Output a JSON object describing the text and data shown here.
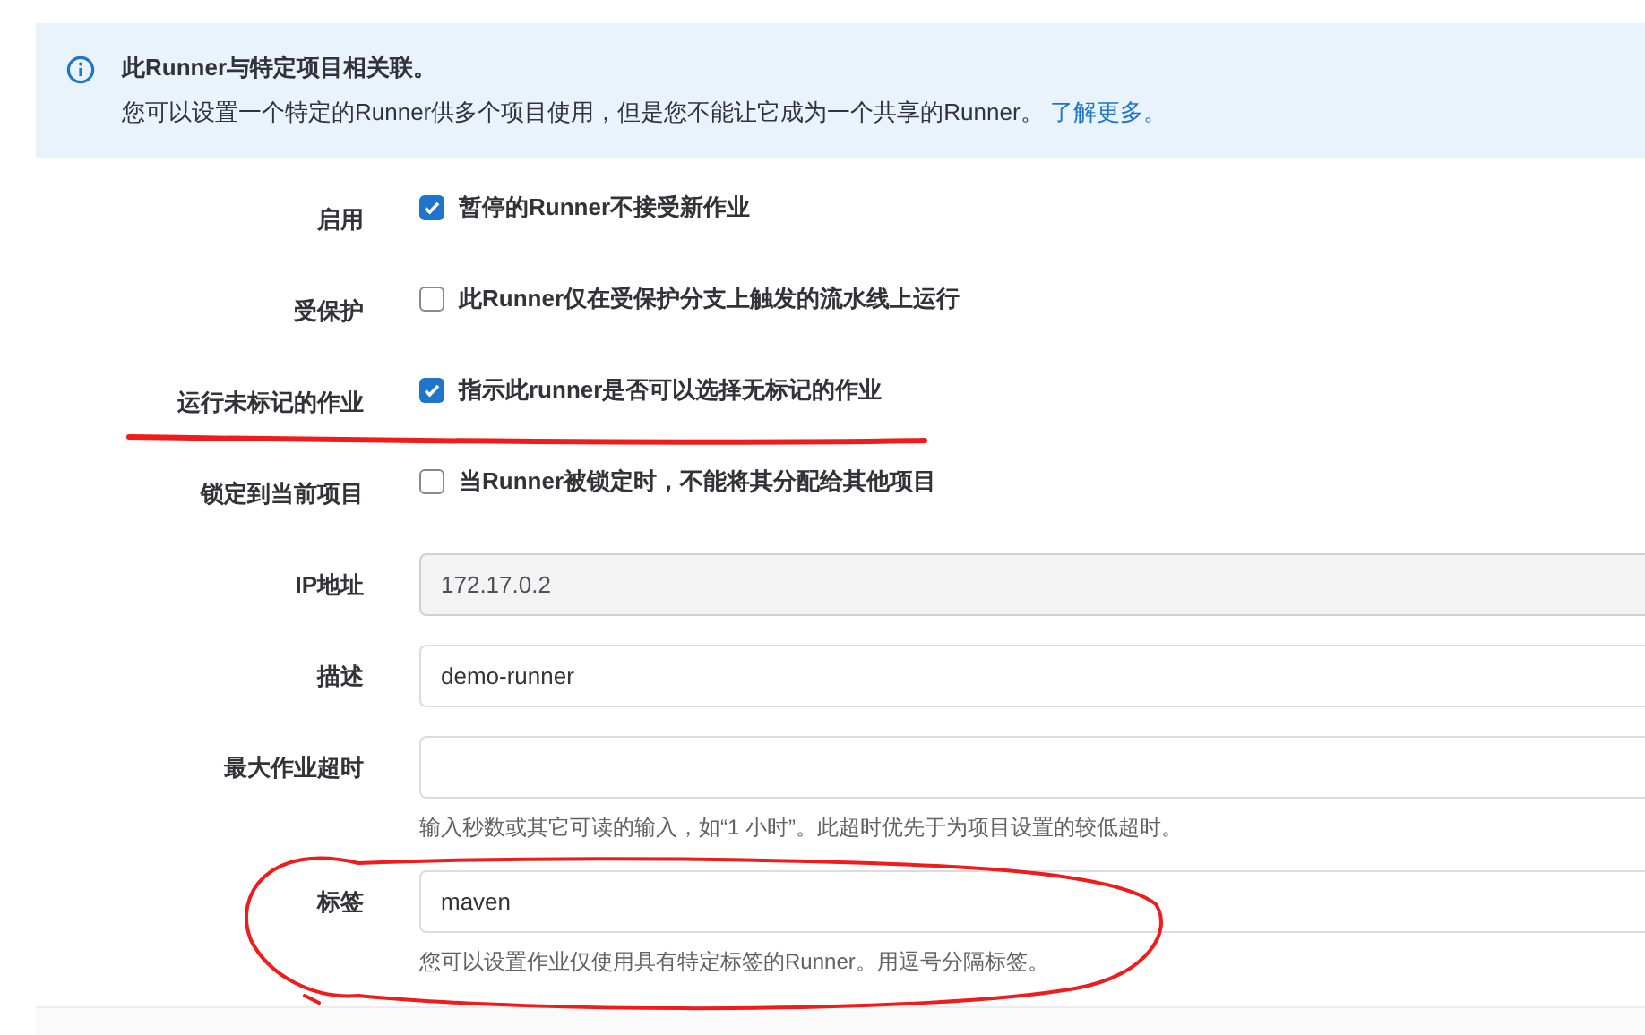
{
  "alert": {
    "title": "此Runner与特定项目相关联。",
    "text": "您可以设置一个特定的Runner供多个项目使用，但是您不能让它成为一个共享的Runner。",
    "link": "了解更多。"
  },
  "checkboxes": [
    {
      "label": "启用",
      "text": "暂停的Runner不接受新作业",
      "checked": true
    },
    {
      "label": "受保护",
      "text": "此Runner仅在受保护分支上触发的流水线上运行",
      "checked": false
    },
    {
      "label": "运行未标记的作业",
      "text": "指示此runner是否可以选择无标记的作业",
      "checked": true
    },
    {
      "label": "锁定到当前项目",
      "text": "当Runner被锁定时，不能将其分配给其他项目",
      "checked": false
    }
  ],
  "fields": [
    {
      "label": "IP地址",
      "value": "172.17.0.2",
      "readonly": true
    },
    {
      "label": "描述",
      "value": "demo-runner",
      "readonly": false
    },
    {
      "label": "最大作业超时",
      "readonly": false,
      "help": "输入秒数或其它可读的输入，如“1 小时”。此超时优先于为项目设置的较低超时。"
    },
    {
      "label": "标签",
      "value": "maven",
      "readonly": false,
      "help": "您可以设置作业仅使用具有特定标签的Runner。用逗号分隔标签。"
    }
  ],
  "annotations": [
    {
      "kind": "underline"
    },
    {
      "kind": "ellipse"
    }
  ]
}
